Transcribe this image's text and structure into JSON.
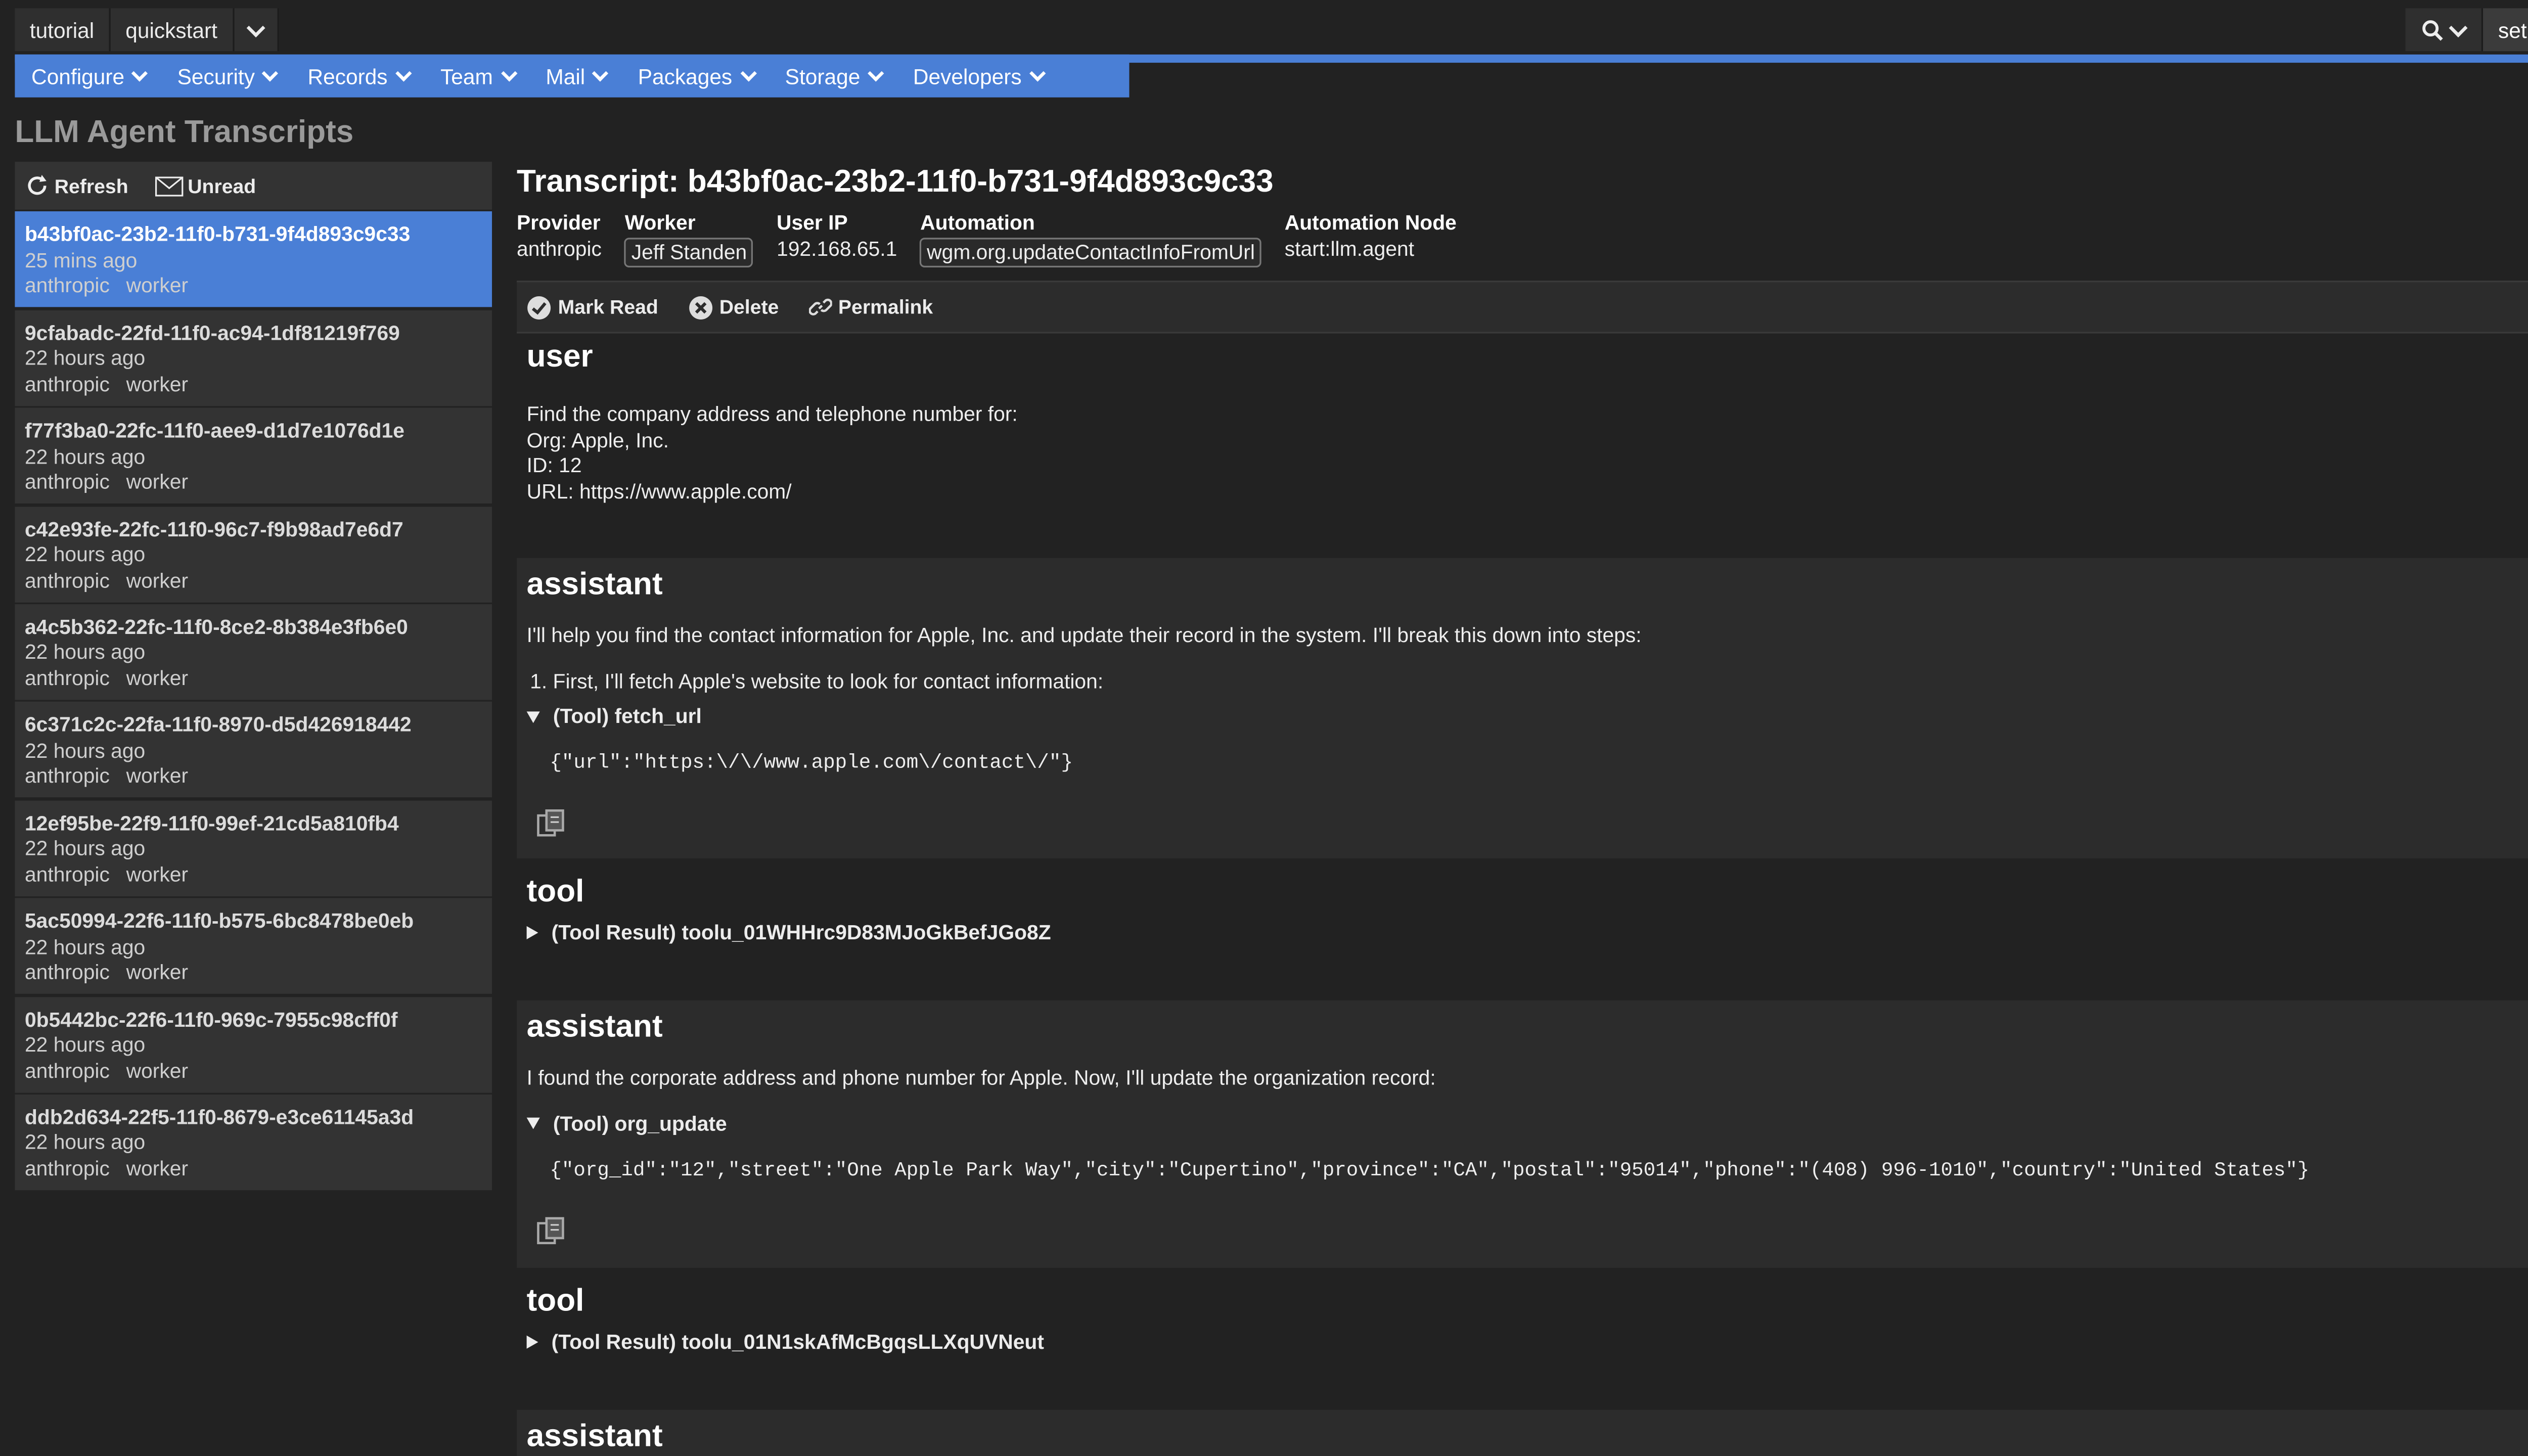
{
  "topbar": {
    "crumbs": [
      "tutorial",
      "quickstart"
    ],
    "setup_label": "setup"
  },
  "nav": [
    "Configure",
    "Security",
    "Records",
    "Team",
    "Mail",
    "Packages",
    "Storage",
    "Developers"
  ],
  "page_title": "LLM Agent Transcripts",
  "sidebar": {
    "refresh_label": "Refresh",
    "unread_label": "Unread",
    "items": [
      {
        "id": "b43bf0ac-23b2-11f0-b731-9f4d893c9c33",
        "time": "25 mins ago",
        "provider": "anthropic",
        "worker": "worker",
        "active": true
      },
      {
        "id": "9cfabadc-22fd-11f0-ac94-1df81219f769",
        "time": "22 hours ago",
        "provider": "anthropic",
        "worker": "worker"
      },
      {
        "id": "f77f3ba0-22fc-11f0-aee9-d1d7e1076d1e",
        "time": "22 hours ago",
        "provider": "anthropic",
        "worker": "worker"
      },
      {
        "id": "c42e93fe-22fc-11f0-96c7-f9b98ad7e6d7",
        "time": "22 hours ago",
        "provider": "anthropic",
        "worker": "worker"
      },
      {
        "id": "a4c5b362-22fc-11f0-8ce2-8b384e3fb6e0",
        "time": "22 hours ago",
        "provider": "anthropic",
        "worker": "worker"
      },
      {
        "id": "6c371c2c-22fa-11f0-8970-d5d426918442",
        "time": "22 hours ago",
        "provider": "anthropic",
        "worker": "worker"
      },
      {
        "id": "12ef95be-22f9-11f0-99ef-21cd5a810fb4",
        "time": "22 hours ago",
        "provider": "anthropic",
        "worker": "worker"
      },
      {
        "id": "5ac50994-22f6-11f0-b575-6bc8478be0eb",
        "time": "22 hours ago",
        "provider": "anthropic",
        "worker": "worker"
      },
      {
        "id": "0b5442bc-22f6-11f0-969c-7955c98cff0f",
        "time": "22 hours ago",
        "provider": "anthropic",
        "worker": "worker"
      },
      {
        "id": "ddb2d634-22f5-11f0-8679-e3ce61145a3d",
        "time": "22 hours ago",
        "provider": "anthropic",
        "worker": "worker"
      }
    ]
  },
  "transcript": {
    "title": "Transcript: b43bf0ac-23b2-11f0-b731-9f4d893c9c33",
    "fields": {
      "provider_label": "Provider",
      "provider": "anthropic",
      "worker_label": "Worker",
      "worker": "Jeff Standen",
      "ip_label": "User IP",
      "ip": "192.168.65.1",
      "automation_label": "Automation",
      "automation": "wgm.org.updateContactInfoFromUrl",
      "node_label": "Automation Node",
      "node": "start:llm.agent"
    },
    "actions": {
      "mark_read": "Mark Read",
      "delete": "Delete",
      "permalink": "Permalink"
    },
    "messages": {
      "m1_role": "user",
      "m1_l1": "Find the company address and telephone number for:",
      "m1_l2": "Org: Apple, Inc.",
      "m1_l3": "ID: 12",
      "m1_l4_prefix": "URL: ",
      "m1_link": "https://www.apple.com/",
      "m2_role": "assistant",
      "m2_l1": "I'll help you find the contact information for Apple, Inc. and update their record in the system. I'll break this down into steps:",
      "m2_l2": "1.  First, I'll fetch Apple's website to look for contact information:",
      "m2_tool": "(Tool) fetch_url",
      "m2_code": "{\"url\":\"https:\\/\\/www.apple.com\\/contact\\/\"}",
      "m3_role": "tool",
      "m3_result": "(Tool Result) toolu_01WHHrc9D83MJoGkBefJGo8Z",
      "m4_role": "assistant",
      "m4_l1": "I found the corporate address and phone number for Apple. Now, I'll update the organization record:",
      "m4_tool": "(Tool) org_update",
      "m4_code": "{\"org_id\":\"12\",\"street\":\"One Apple Park Way\",\"city\":\"Cupertino\",\"province\":\"CA\",\"postal\":\"95014\",\"phone\":\"(408) 996-1010\",\"country\":\"United States\"}",
      "m5_role": "tool",
      "m5_result": "(Tool Result) toolu_01N1skAfMcBgqsLLXqUVNeut",
      "m6_role": "assistant"
    }
  },
  "colors": {
    "accent": "#4a7fd6",
    "background": "#222222",
    "panel": "#333333"
  }
}
